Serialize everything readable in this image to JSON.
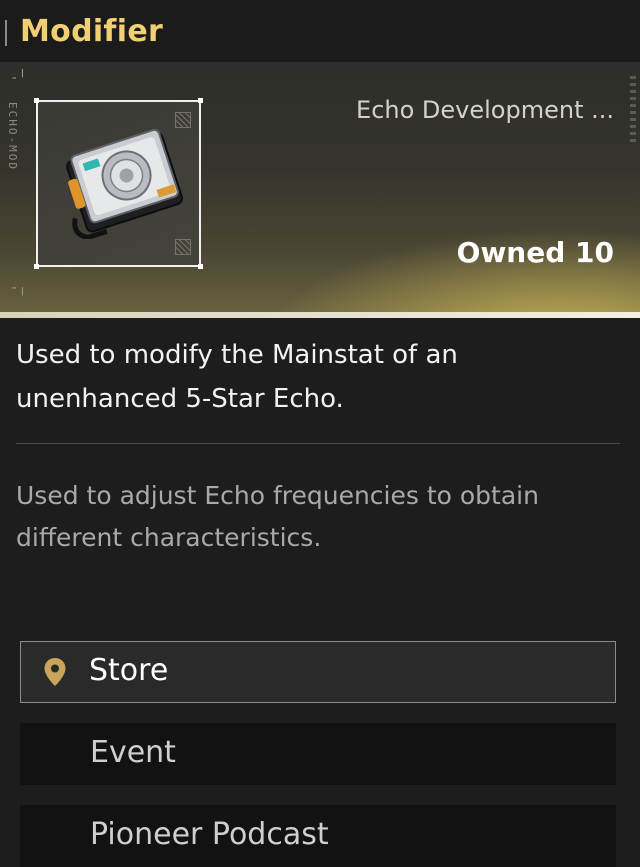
{
  "header": {
    "title": "Modifier"
  },
  "item": {
    "category": "Echo Development ...",
    "owned": "Owned 10",
    "side_text": "ECHO-MOD"
  },
  "description": {
    "main": "Used to modify the Mainstat of an unenhanced 5-Star Echo.",
    "sub": "Used to adjust Echo frequencies to obtain different characteristics."
  },
  "sources": [
    {
      "label": "Store",
      "icon": "location-pin-icon",
      "selected": true
    },
    {
      "label": "Event",
      "selected": false
    },
    {
      "label": "Pioneer Podcast",
      "selected": false
    }
  ],
  "colors": {
    "title_accent": "#f1cf73",
    "pin_accent": "#c9a45a",
    "banner_glow": "#d6be5a"
  }
}
